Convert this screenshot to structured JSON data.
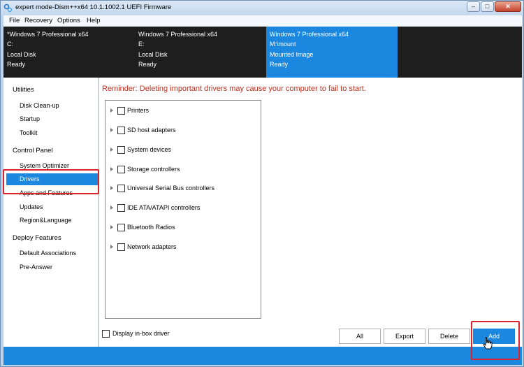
{
  "window": {
    "title": "expert mode-Dism++x64 10.1.1002.1 UEFI Firmware",
    "controls": {
      "minimize": "–",
      "maximize": "□",
      "close": "✕"
    }
  },
  "menu": [
    "File",
    "Recovery",
    "Options",
    "Help"
  ],
  "images": [
    {
      "name": "*Windows 7 Professional x64",
      "drive": "C:",
      "type": "Local Disk",
      "status": "Ready",
      "selected": false
    },
    {
      "name": "Windows 7 Professional x64",
      "drive": "E:",
      "type": "Local Disk",
      "status": "Ready",
      "selected": false
    },
    {
      "name": "Windows 7 Professional x64",
      "drive": "M:\\mount",
      "type": "Mounted Image",
      "status": "Ready",
      "selected": true
    }
  ],
  "sidebar": {
    "utilities_heading": "Utilities",
    "utilities": [
      "Disk Clean-up",
      "Startup",
      "Toolkit"
    ],
    "control_panel_heading": "Control Panel",
    "control_panel": [
      "System Optimizer",
      "Drivers",
      "Apps and Features",
      "Updates",
      "Region&Language"
    ],
    "deploy_heading": "Deploy Features",
    "deploy": [
      "Default Associations",
      "Pre-Answer"
    ],
    "active_item": "Drivers"
  },
  "main": {
    "reminder": "Reminder: Deleting important drivers may cause your computer to fail to start.",
    "driver_categories": [
      "Printers",
      "SD host adapters",
      "System devices",
      "Storage controllers",
      "Universal Serial Bus controllers",
      "IDE ATA/ATAPI controllers",
      "Bluetooth Radios",
      "Network adapters"
    ],
    "display_inbox_label": "Display in-box driver",
    "buttons": {
      "all": "All",
      "export": "Export",
      "delete": "Delete",
      "add": "Add"
    }
  },
  "colors": {
    "accent": "#1c87df",
    "highlight": "#d9232e",
    "reminder": "#c0301f"
  }
}
